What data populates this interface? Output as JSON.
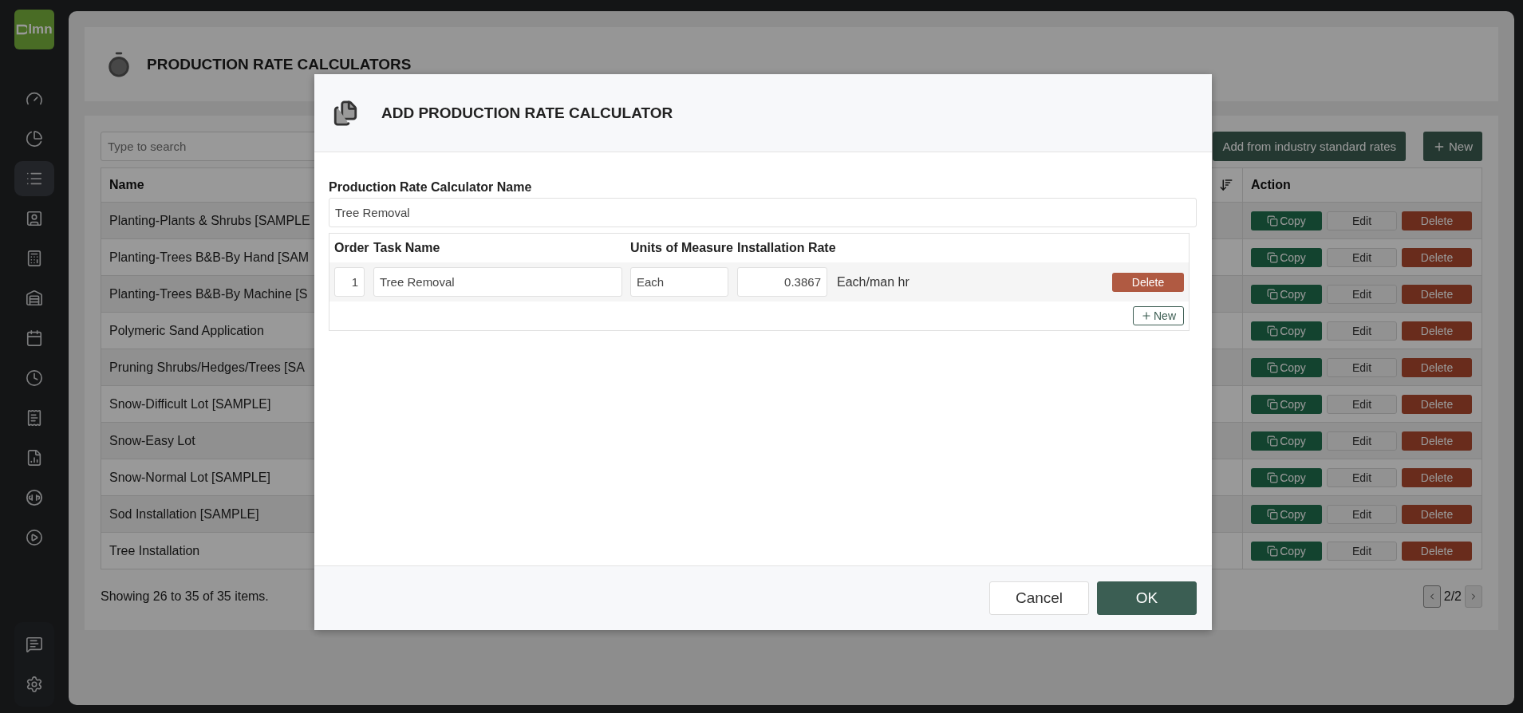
{
  "logo": {
    "text": "lmn"
  },
  "sidebar": {
    "items": [
      {
        "selected": false
      },
      {
        "selected": false
      },
      {
        "selected": true
      },
      {
        "selected": false
      },
      {
        "selected": false
      },
      {
        "selected": false
      },
      {
        "selected": false
      },
      {
        "selected": false
      },
      {
        "selected": false
      },
      {
        "selected": false
      },
      {
        "selected": false
      },
      {
        "selected": false
      }
    ],
    "bottom_items": [
      {
        "selected": false
      },
      {
        "selected": false
      }
    ]
  },
  "page": {
    "title": "PRODUCTION RATE CALCULATORS"
  },
  "toolbar": {
    "search_placeholder": "Type to search",
    "buttons": [
      "Add from industry standard rates",
      "New"
    ]
  },
  "table": {
    "columns": [
      "Name",
      "Action"
    ],
    "rows": [
      {
        "name": "Planting-Plants & Shrubs [SAMPLE",
        "actions": [
          "Copy",
          "Edit",
          "Delete"
        ]
      },
      {
        "name": "Planting-Trees B&B-By Hand [SAM",
        "actions": [
          "Copy",
          "Edit",
          "Delete"
        ]
      },
      {
        "name": "Planting-Trees B&B-By Machine [S",
        "actions": [
          "Copy",
          "Edit",
          "Delete"
        ]
      },
      {
        "name": "Polymeric Sand Application",
        "actions": [
          "Copy",
          "Edit",
          "Delete"
        ]
      },
      {
        "name": "Pruning Shrubs/Hedges/Trees [SA",
        "actions": [
          "Copy",
          "Edit",
          "Delete"
        ]
      },
      {
        "name": "Snow-Difficult Lot [SAMPLE]",
        "actions": [
          "Copy",
          "Edit",
          "Delete"
        ]
      },
      {
        "name": "Snow-Easy Lot",
        "actions": [
          "Copy",
          "Edit",
          "Delete"
        ]
      },
      {
        "name": "Snow-Normal Lot [SAMPLE]",
        "actions": [
          "Copy",
          "Edit",
          "Delete"
        ]
      },
      {
        "name": "Sod Installation [SAMPLE]",
        "actions": [
          "Copy",
          "Edit",
          "Delete"
        ]
      },
      {
        "name": "Tree Installation",
        "actions": [
          "Copy",
          "Edit",
          "Delete"
        ]
      }
    ]
  },
  "footer": {
    "summary": "Showing 26 to 35 of 35 items.",
    "page": "2/2"
  },
  "modal": {
    "title": "ADD PRODUCTION RATE CALCULATOR",
    "name_label": "Production Rate Calculator Name",
    "name_value": "Tree Removal",
    "task_columns": [
      "Order",
      "Task Name",
      "Units of Measure",
      "Installation Rate"
    ],
    "tasks": [
      {
        "order": "1",
        "task_name": "Tree Removal",
        "units": "Each",
        "rate": "0.3867",
        "rate_unit": "Each/man hr",
        "delete": "Delete"
      }
    ],
    "new_button": "New",
    "buttons": [
      "Cancel",
      "OK"
    ]
  }
}
